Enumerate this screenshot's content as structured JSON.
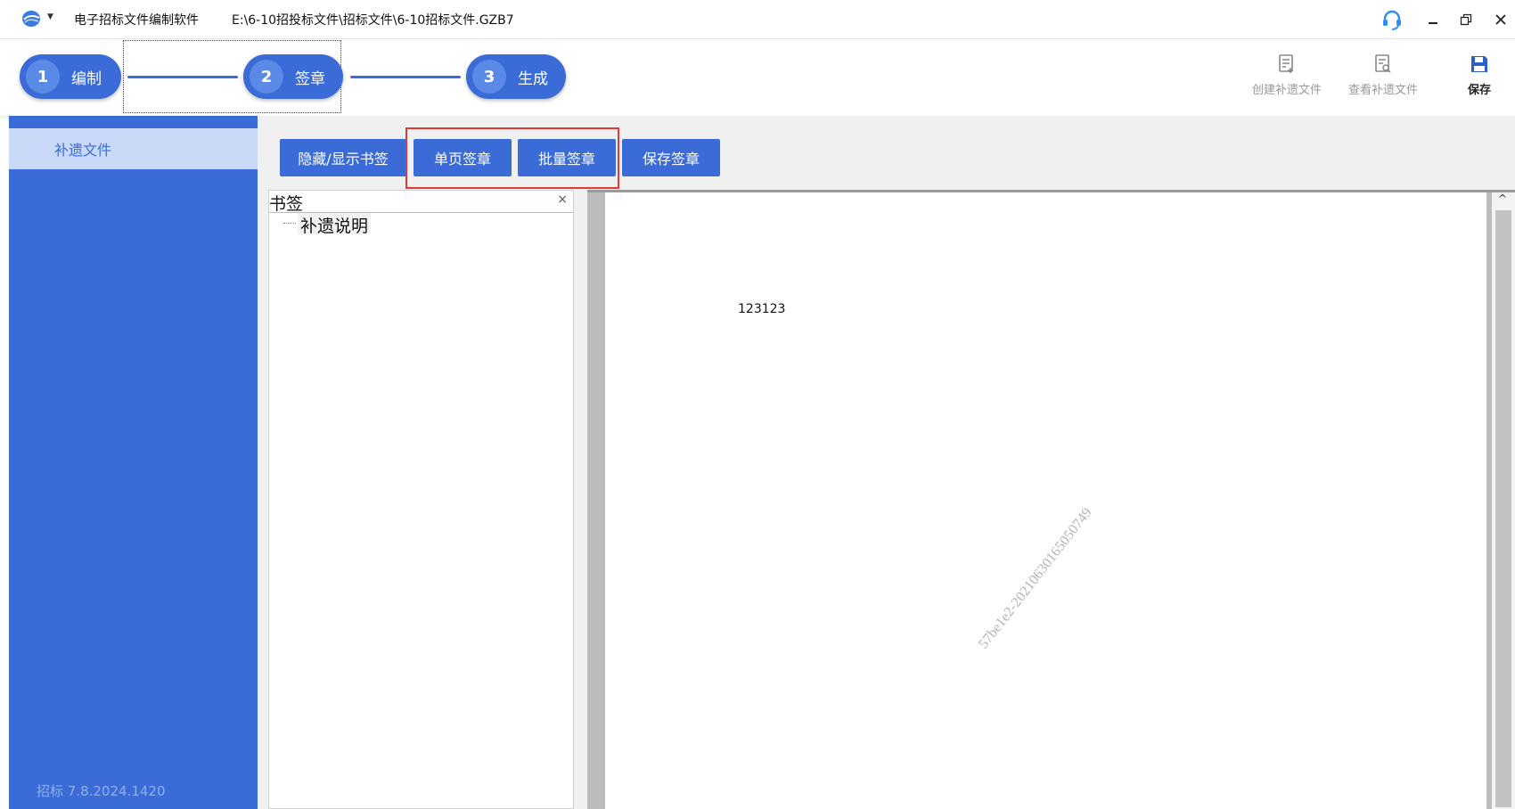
{
  "titlebar": {
    "app_name": "电子招标文件编制软件",
    "file_path": "E:\\6-10招投标文件\\招标文件\\6-10招标文件.GZB7"
  },
  "steps": [
    {
      "number": "1",
      "label": "编制"
    },
    {
      "number": "2",
      "label": "签章"
    },
    {
      "number": "3",
      "label": "生成"
    }
  ],
  "toolbar": {
    "create_label": "创建补遗文件",
    "view_label": "查看补遗文件",
    "save_label": "保存"
  },
  "sidebar": {
    "items": [
      {
        "label": "补遗文件"
      }
    ],
    "version": "招标   7.8.2024.1420"
  },
  "actions": {
    "toggle_bookmark": "隐藏/显示书签",
    "single_stamp": "单页签章",
    "batch_stamp": "批量签章",
    "save_stamp": "保存签章"
  },
  "bookmark": {
    "title": "书签",
    "close": "×",
    "nodes": [
      {
        "label": "补遗说明"
      }
    ]
  },
  "document": {
    "text": "123123",
    "watermark": "57be1e2-20210630165050749"
  },
  "colors": {
    "accent": "#3a6bd6",
    "sidebar_selected": "#c9daf8",
    "highlight": "#e53935"
  }
}
